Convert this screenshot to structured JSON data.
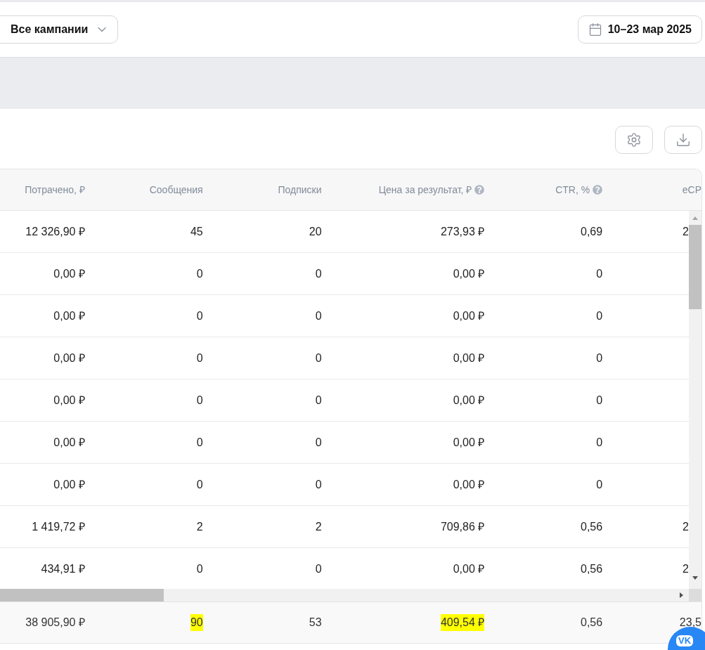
{
  "campaign_filter": {
    "value": "Все кампании"
  },
  "date_range": {
    "value": "10–23 мар 2025"
  },
  "table": {
    "columns": [
      {
        "label": "Потрачено, ₽",
        "help": false
      },
      {
        "label": "Сообщения",
        "help": false
      },
      {
        "label": "Подписки",
        "help": false
      },
      {
        "label": "Цена за результат, ₽",
        "help": true
      },
      {
        "label": "CTR, %",
        "help": true
      },
      {
        "label": "eCP",
        "help": false
      }
    ],
    "rows": [
      [
        "12 326,90 ₽",
        "45",
        "20",
        "273,93 ₽",
        "0,69",
        "2"
      ],
      [
        "0,00 ₽",
        "0",
        "0",
        "0,00 ₽",
        "0",
        ""
      ],
      [
        "0,00 ₽",
        "0",
        "0",
        "0,00 ₽",
        "0",
        ""
      ],
      [
        "0,00 ₽",
        "0",
        "0",
        "0,00 ₽",
        "0",
        ""
      ],
      [
        "0,00 ₽",
        "0",
        "0",
        "0,00 ₽",
        "0",
        ""
      ],
      [
        "0,00 ₽",
        "0",
        "0",
        "0,00 ₽",
        "0",
        ""
      ],
      [
        "0,00 ₽",
        "0",
        "0",
        "0,00 ₽",
        "0",
        ""
      ],
      [
        "1 419,72 ₽",
        "2",
        "2",
        "709,86 ₽",
        "0,56",
        "2"
      ],
      [
        "434,91 ₽",
        "0",
        "0",
        "0,00 ₽",
        "0,56",
        "2"
      ]
    ],
    "totals": [
      {
        "text": "38 905,90 ₽",
        "highlighted": false
      },
      {
        "text": "90",
        "highlighted": true
      },
      {
        "text": "53",
        "highlighted": false
      },
      {
        "text": "409,54 ₽",
        "highlighted": true
      },
      {
        "text": "0,56",
        "highlighted": false
      },
      {
        "text": "23,5",
        "highlighted": false
      }
    ]
  },
  "chat_button": {
    "label": "VK"
  }
}
